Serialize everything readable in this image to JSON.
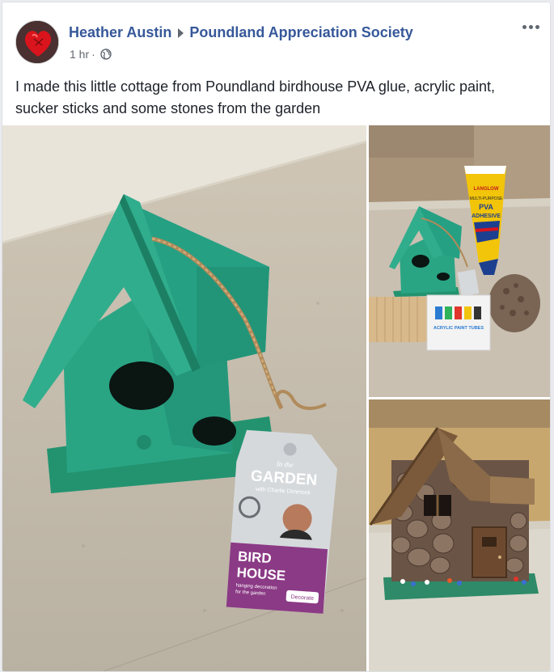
{
  "post": {
    "author": "Heather Austin",
    "group": "Poundland Appreciation Society",
    "time": "1 hr",
    "separator": "·",
    "body": "I made this little cottage from Poundland birdhouse PVA glue, acrylic paint, sucker sticks and some stones from the garden"
  },
  "icons": {
    "avatar": "heart-avatar",
    "audience": "globe-icon",
    "more": "more-options-icon",
    "arrow": "triangle-right-icon"
  },
  "photos": {
    "main": {
      "tag_line1": "In the",
      "tag_line2": "GARDEN",
      "tag_line3": "with Charlie Dimmock",
      "tag_line4": "BIRD",
      "tag_line5": "HOUSE",
      "tag_line6": "hanging decoration",
      "tag_line7": "for the garden",
      "tag_line8": "Decorate"
    },
    "supplies": {
      "glue_brand": "LANGLOW",
      "glue_line1": "MULTI-PURPOSE",
      "glue_line2": "PVA",
      "glue_line3": "ADHESIVE",
      "paint_label": "ACRYLIC PAINT TUBES"
    }
  },
  "colors": {
    "link": "#365899",
    "meta": "#616770",
    "card_bg": "#ffffff",
    "page_bg": "#e9ebee",
    "birdhouse_green": "#2aa584",
    "tag_purple": "#8b3a85"
  }
}
